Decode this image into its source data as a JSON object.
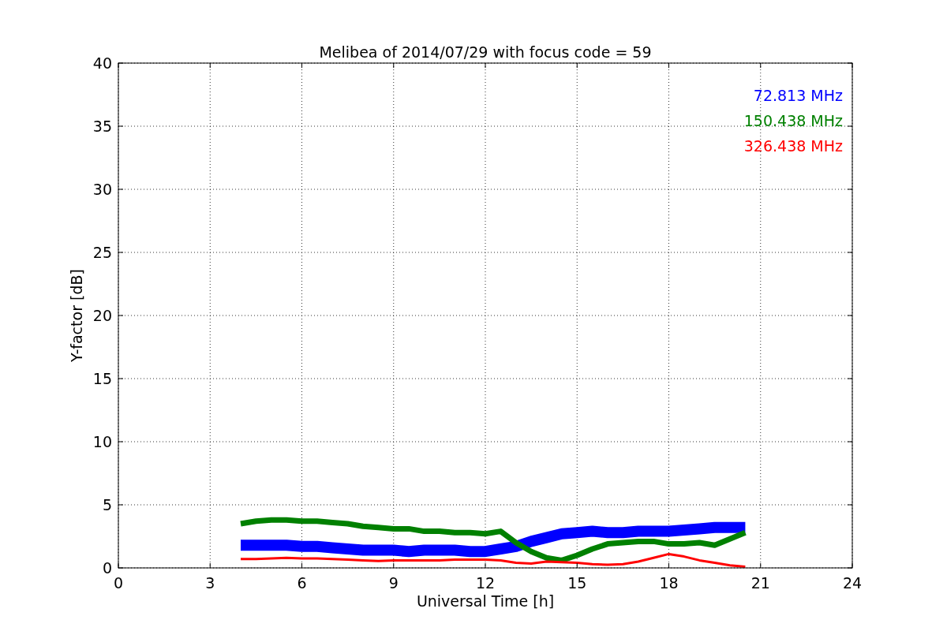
{
  "chart_data": {
    "type": "line",
    "title": "Melibea of 2014/07/29 with focus code = 59",
    "xlabel": "Universal Time [h]",
    "ylabel": "Y-factor [dB]",
    "x": [
      4,
      4.5,
      5,
      5.5,
      6,
      6.5,
      7,
      7.5,
      8,
      8.5,
      9,
      9.5,
      10,
      10.5,
      11,
      11.5,
      12,
      12.5,
      13,
      13.5,
      14,
      14.5,
      15,
      15.5,
      16,
      16.5,
      17,
      17.5,
      18,
      18.5,
      19,
      19.5,
      20,
      20.5
    ],
    "series": [
      {
        "name": "72.813 MHz",
        "color": "#0000ff",
        "values": [
          1.8,
          1.8,
          1.8,
          1.8,
          1.7,
          1.7,
          1.6,
          1.5,
          1.4,
          1.4,
          1.4,
          1.3,
          1.4,
          1.4,
          1.4,
          1.3,
          1.3,
          1.5,
          1.7,
          2.1,
          2.4,
          2.7,
          2.8,
          2.9,
          2.8,
          2.8,
          2.9,
          2.9,
          2.9,
          3.0,
          3.1,
          3.2,
          3.2,
          3.2
        ]
      },
      {
        "name": "150.438 MHz",
        "color": "#008000",
        "values": [
          3.5,
          3.7,
          3.8,
          3.8,
          3.7,
          3.7,
          3.6,
          3.5,
          3.3,
          3.2,
          3.1,
          3.1,
          2.9,
          2.9,
          2.8,
          2.8,
          2.7,
          2.9,
          2.0,
          1.3,
          0.8,
          0.6,
          1.0,
          1.5,
          1.9,
          2.0,
          2.1,
          2.1,
          1.9,
          1.9,
          2.0,
          1.8,
          2.3,
          2.8
        ]
      },
      {
        "name": "326.438 MHz",
        "color": "#ff0000",
        "values": [
          0.7,
          0.7,
          0.75,
          0.8,
          0.75,
          0.75,
          0.7,
          0.65,
          0.6,
          0.55,
          0.6,
          0.6,
          0.6,
          0.6,
          0.65,
          0.65,
          0.65,
          0.6,
          0.4,
          0.35,
          0.5,
          0.45,
          0.4,
          0.3,
          0.25,
          0.3,
          0.5,
          0.8,
          1.1,
          0.9,
          0.6,
          0.4,
          0.2,
          0.1
        ]
      }
    ],
    "xlim": [
      0,
      24
    ],
    "ylim": [
      0,
      40
    ],
    "xticks": [
      0,
      3,
      6,
      9,
      12,
      15,
      18,
      21,
      24
    ],
    "yticks": [
      0,
      5,
      10,
      15,
      20,
      25,
      30,
      35,
      40
    ],
    "grid": true
  }
}
